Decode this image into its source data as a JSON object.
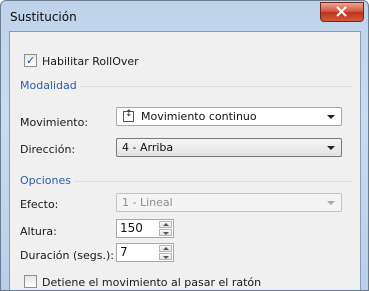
{
  "window": {
    "title": "Sustitución"
  },
  "rollover": {
    "label": "Habilitar RollOver",
    "checked": true
  },
  "modalidad": {
    "group_label": "Modalidad",
    "movimiento_label": "Movimiento:",
    "movimiento_value": "Movimiento continuo",
    "direccion_label": "Dirección:",
    "direccion_value": "4 - Arriba"
  },
  "opciones": {
    "group_label": "Opciones",
    "efecto_label": "Efecto:",
    "efecto_value": "1 - Lineal",
    "altura_label": "Altura:",
    "altura_value": "150",
    "duracion_label": "Duración (segs.):",
    "duracion_value": "7",
    "stop_label": "Detiene el movimiento al pasar el ratón",
    "stop_checked": false
  },
  "colors": {
    "group_label": "#2b5ea8",
    "close_button": "#c9462c"
  }
}
